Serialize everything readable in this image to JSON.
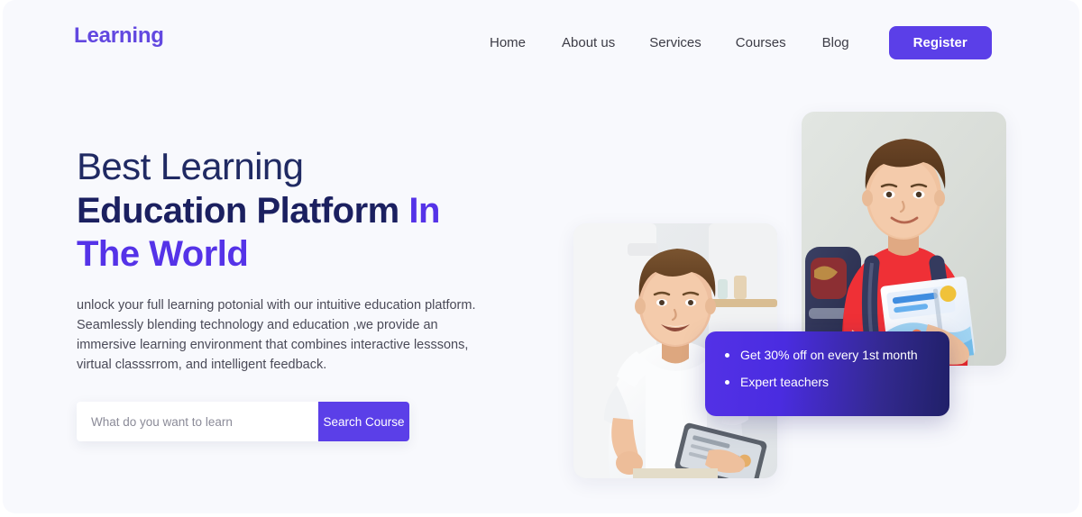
{
  "header": {
    "logo": "Learning",
    "nav_items": [
      {
        "label": "Home"
      },
      {
        "label": "About us"
      },
      {
        "label": "Services"
      },
      {
        "label": "Courses"
      },
      {
        "label": "Blog"
      }
    ],
    "register_label": "Register"
  },
  "hero": {
    "headline_line1": "Best Learning",
    "headline_line2": "Education Platform",
    "headline_line2_accent": "In",
    "headline_line3": "The World",
    "paragraph": "unlock your full learning potonial with our intuitive education platform. Seamlessly blending technology and education ,we provide an immersive learning environment that combines interactive lesssons, virtual classsrrom, and intelligent feedback."
  },
  "search": {
    "placeholder": "What do you want to learn",
    "value": "",
    "button_label": "Search Course"
  },
  "promo": {
    "items": [
      {
        "label": "Get 30% off on every 1st month"
      },
      {
        "label": "Expert teachers"
      }
    ]
  },
  "photos": {
    "front": {
      "alt": "Smiling boy in white t-shirt holding a tablet"
    },
    "back": {
      "alt": "Smiling boy in red shirt with backpack holding books"
    }
  },
  "colors": {
    "page_background": "#f8f9fd",
    "brand_purple": "#5b3fe8",
    "logo_purple": "#6248e0",
    "headline_navy": "#1b2060",
    "headline_accent": "#5533e8",
    "nav_text": "#3c3c46",
    "paragraph_text": "#4a4a57",
    "promo_gradient_start": "#5331e6",
    "promo_gradient_end": "#202068"
  }
}
